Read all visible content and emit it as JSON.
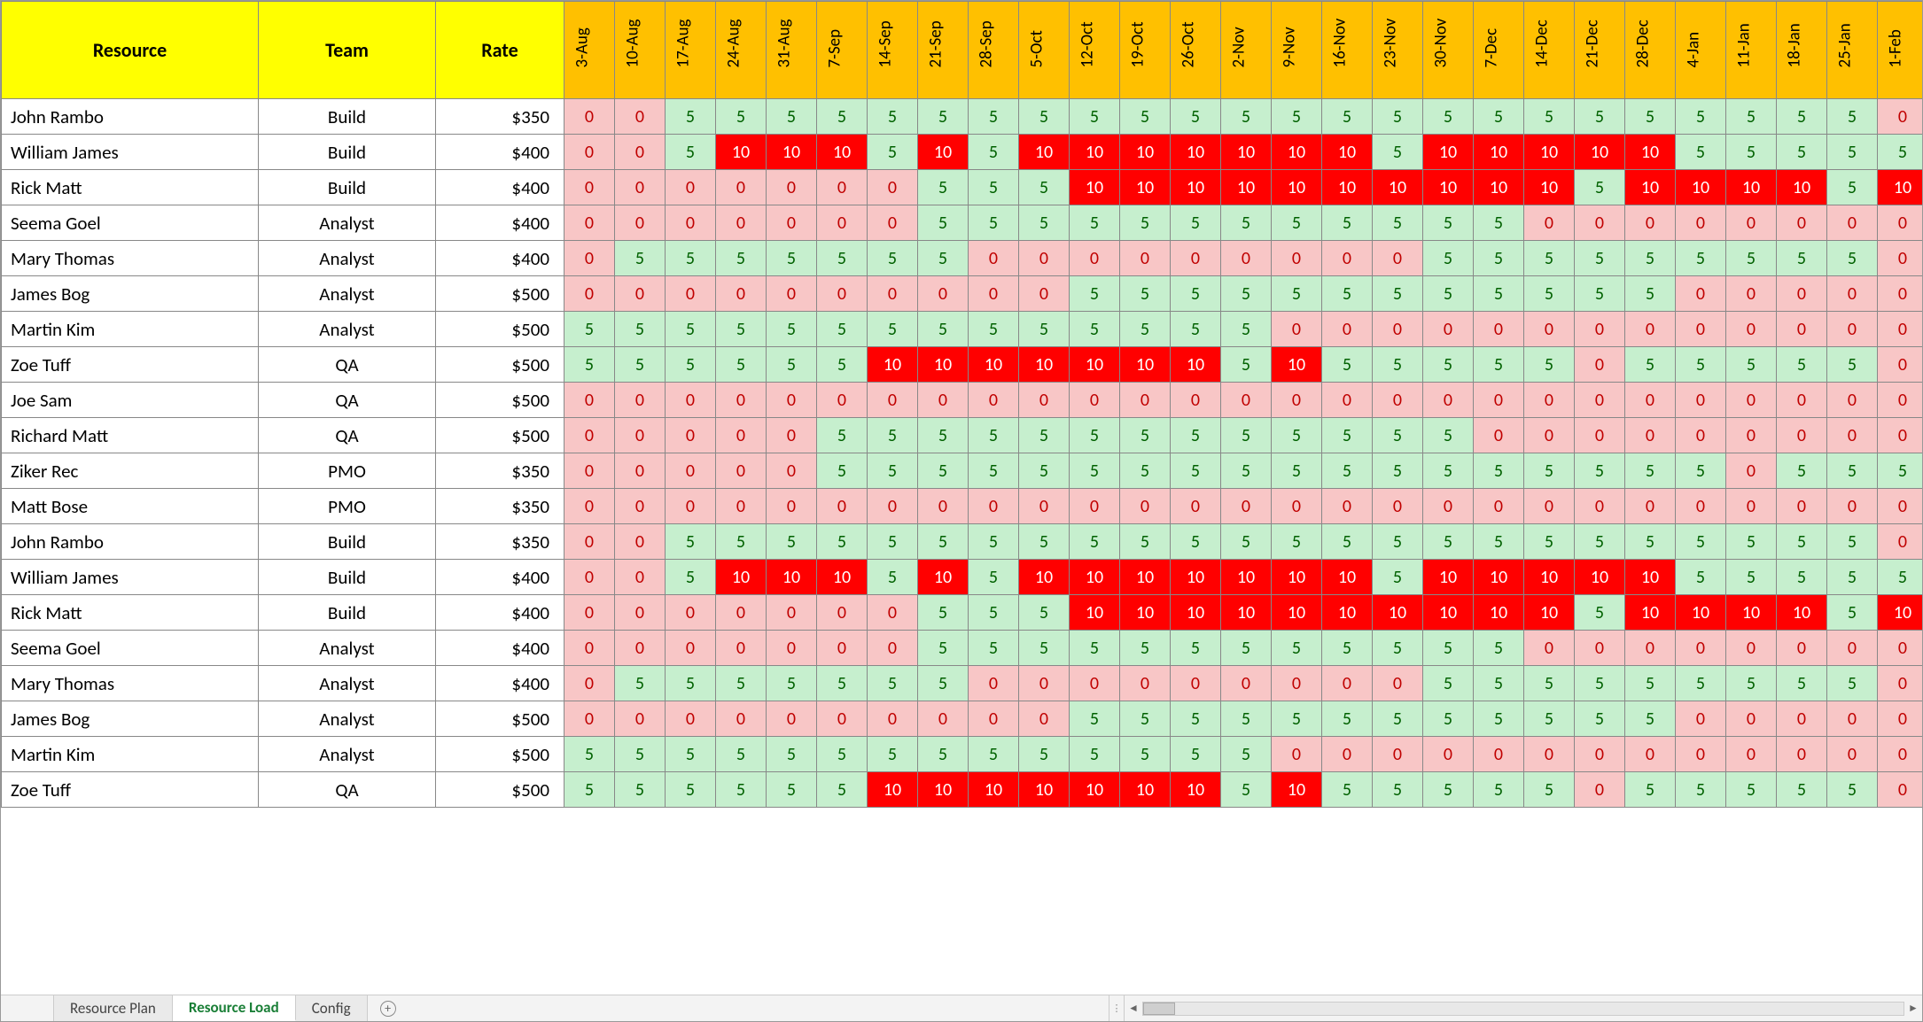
{
  "headers": {
    "resource": "Resource",
    "team": "Team",
    "rate": "Rate"
  },
  "dates": [
    "3-Aug",
    "10-Aug",
    "17-Aug",
    "24-Aug",
    "31-Aug",
    "7-Sep",
    "14-Sep",
    "21-Sep",
    "28-Sep",
    "5-Oct",
    "12-Oct",
    "19-Oct",
    "26-Oct",
    "2-Nov",
    "9-Nov",
    "16-Nov",
    "23-Nov",
    "30-Nov",
    "7-Dec",
    "14-Dec",
    "21-Dec",
    "28-Dec",
    "4-Jan",
    "11-Jan",
    "18-Jan",
    "25-Jan",
    "1-Feb"
  ],
  "rows": [
    {
      "name": "John Rambo",
      "team": "Build",
      "rate": "$350",
      "vals": [
        0,
        0,
        5,
        5,
        5,
        5,
        5,
        5,
        5,
        5,
        5,
        5,
        5,
        5,
        5,
        5,
        5,
        5,
        5,
        5,
        5,
        5,
        5,
        5,
        5,
        5,
        0
      ]
    },
    {
      "name": "William James",
      "team": "Build",
      "rate": "$400",
      "vals": [
        0,
        0,
        5,
        10,
        10,
        10,
        5,
        10,
        5,
        10,
        10,
        10,
        10,
        10,
        10,
        10,
        5,
        10,
        10,
        10,
        10,
        10,
        5,
        5,
        5,
        5,
        5
      ]
    },
    {
      "name": "Rick Matt",
      "team": "Build",
      "rate": "$400",
      "vals": [
        0,
        0,
        0,
        0,
        0,
        0,
        0,
        5,
        5,
        5,
        10,
        10,
        10,
        10,
        10,
        10,
        10,
        10,
        10,
        10,
        5,
        10,
        10,
        10,
        10,
        5,
        10
      ]
    },
    {
      "name": "Seema Goel",
      "team": "Analyst",
      "rate": "$400",
      "vals": [
        0,
        0,
        0,
        0,
        0,
        0,
        0,
        5,
        5,
        5,
        5,
        5,
        5,
        5,
        5,
        5,
        5,
        5,
        5,
        0,
        0,
        0,
        0,
        0,
        0,
        0,
        0
      ]
    },
    {
      "name": "Mary Thomas",
      "team": "Analyst",
      "rate": "$400",
      "vals": [
        0,
        5,
        5,
        5,
        5,
        5,
        5,
        5,
        0,
        0,
        0,
        0,
        0,
        0,
        0,
        0,
        0,
        5,
        5,
        5,
        5,
        5,
        5,
        5,
        5,
        5,
        0
      ]
    },
    {
      "name": "James Bog",
      "team": "Analyst",
      "rate": "$500",
      "vals": [
        0,
        0,
        0,
        0,
        0,
        0,
        0,
        0,
        0,
        0,
        5,
        5,
        5,
        5,
        5,
        5,
        5,
        5,
        5,
        5,
        5,
        5,
        0,
        0,
        0,
        0,
        0
      ]
    },
    {
      "name": "Martin Kim",
      "team": "Analyst",
      "rate": "$500",
      "vals": [
        5,
        5,
        5,
        5,
        5,
        5,
        5,
        5,
        5,
        5,
        5,
        5,
        5,
        5,
        0,
        0,
        0,
        0,
        0,
        0,
        0,
        0,
        0,
        0,
        0,
        0,
        0
      ]
    },
    {
      "name": "Zoe Tuff",
      "team": "QA",
      "rate": "$500",
      "vals": [
        5,
        5,
        5,
        5,
        5,
        5,
        10,
        10,
        10,
        10,
        10,
        10,
        10,
        5,
        10,
        5,
        5,
        5,
        5,
        5,
        0,
        5,
        5,
        5,
        5,
        5,
        0
      ]
    },
    {
      "name": "Joe Sam",
      "team": "QA",
      "rate": "$500",
      "vals": [
        0,
        0,
        0,
        0,
        0,
        0,
        0,
        0,
        0,
        0,
        0,
        0,
        0,
        0,
        0,
        0,
        0,
        0,
        0,
        0,
        0,
        0,
        0,
        0,
        0,
        0,
        0
      ]
    },
    {
      "name": "Richard Matt",
      "team": "QA",
      "rate": "$500",
      "vals": [
        0,
        0,
        0,
        0,
        0,
        5,
        5,
        5,
        5,
        5,
        5,
        5,
        5,
        5,
        5,
        5,
        5,
        5,
        0,
        0,
        0,
        0,
        0,
        0,
        0,
        0,
        0
      ]
    },
    {
      "name": "Ziker Rec",
      "team": "PMO",
      "rate": "$350",
      "vals": [
        0,
        0,
        0,
        0,
        0,
        5,
        5,
        5,
        5,
        5,
        5,
        5,
        5,
        5,
        5,
        5,
        5,
        5,
        5,
        5,
        5,
        5,
        5,
        0,
        5,
        5,
        5
      ]
    },
    {
      "name": "Matt Bose",
      "team": "PMO",
      "rate": "$350",
      "vals": [
        0,
        0,
        0,
        0,
        0,
        0,
        0,
        0,
        0,
        0,
        0,
        0,
        0,
        0,
        0,
        0,
        0,
        0,
        0,
        0,
        0,
        0,
        0,
        0,
        0,
        0,
        0
      ]
    },
    {
      "name": "John Rambo",
      "team": "Build",
      "rate": "$350",
      "vals": [
        0,
        0,
        5,
        5,
        5,
        5,
        5,
        5,
        5,
        5,
        5,
        5,
        5,
        5,
        5,
        5,
        5,
        5,
        5,
        5,
        5,
        5,
        5,
        5,
        5,
        5,
        0
      ]
    },
    {
      "name": "William James",
      "team": "Build",
      "rate": "$400",
      "vals": [
        0,
        0,
        5,
        10,
        10,
        10,
        5,
        10,
        5,
        10,
        10,
        10,
        10,
        10,
        10,
        10,
        5,
        10,
        10,
        10,
        10,
        10,
        5,
        5,
        5,
        5,
        5
      ]
    },
    {
      "name": "Rick Matt",
      "team": "Build",
      "rate": "$400",
      "vals": [
        0,
        0,
        0,
        0,
        0,
        0,
        0,
        5,
        5,
        5,
        10,
        10,
        10,
        10,
        10,
        10,
        10,
        10,
        10,
        10,
        5,
        10,
        10,
        10,
        10,
        5,
        10
      ]
    },
    {
      "name": "Seema Goel",
      "team": "Analyst",
      "rate": "$400",
      "vals": [
        0,
        0,
        0,
        0,
        0,
        0,
        0,
        5,
        5,
        5,
        5,
        5,
        5,
        5,
        5,
        5,
        5,
        5,
        5,
        0,
        0,
        0,
        0,
        0,
        0,
        0,
        0
      ]
    },
    {
      "name": "Mary Thomas",
      "team": "Analyst",
      "rate": "$400",
      "vals": [
        0,
        5,
        5,
        5,
        5,
        5,
        5,
        5,
        0,
        0,
        0,
        0,
        0,
        0,
        0,
        0,
        0,
        5,
        5,
        5,
        5,
        5,
        5,
        5,
        5,
        5,
        0
      ]
    },
    {
      "name": "James Bog",
      "team": "Analyst",
      "rate": "$500",
      "vals": [
        0,
        0,
        0,
        0,
        0,
        0,
        0,
        0,
        0,
        0,
        5,
        5,
        5,
        5,
        5,
        5,
        5,
        5,
        5,
        5,
        5,
        5,
        0,
        0,
        0,
        0,
        0
      ]
    },
    {
      "name": "Martin Kim",
      "team": "Analyst",
      "rate": "$500",
      "vals": [
        5,
        5,
        5,
        5,
        5,
        5,
        5,
        5,
        5,
        5,
        5,
        5,
        5,
        5,
        0,
        0,
        0,
        0,
        0,
        0,
        0,
        0,
        0,
        0,
        0,
        0,
        0
      ]
    },
    {
      "name": "Zoe Tuff",
      "team": "QA",
      "rate": "$500",
      "vals": [
        5,
        5,
        5,
        5,
        5,
        5,
        10,
        10,
        10,
        10,
        10,
        10,
        10,
        5,
        10,
        5,
        5,
        5,
        5,
        5,
        0,
        5,
        5,
        5,
        5,
        5,
        0
      ]
    }
  ],
  "tabs": [
    {
      "label": "Resource Plan",
      "active": false
    },
    {
      "label": "Resource Load",
      "active": true
    },
    {
      "label": "Config",
      "active": false
    }
  ]
}
